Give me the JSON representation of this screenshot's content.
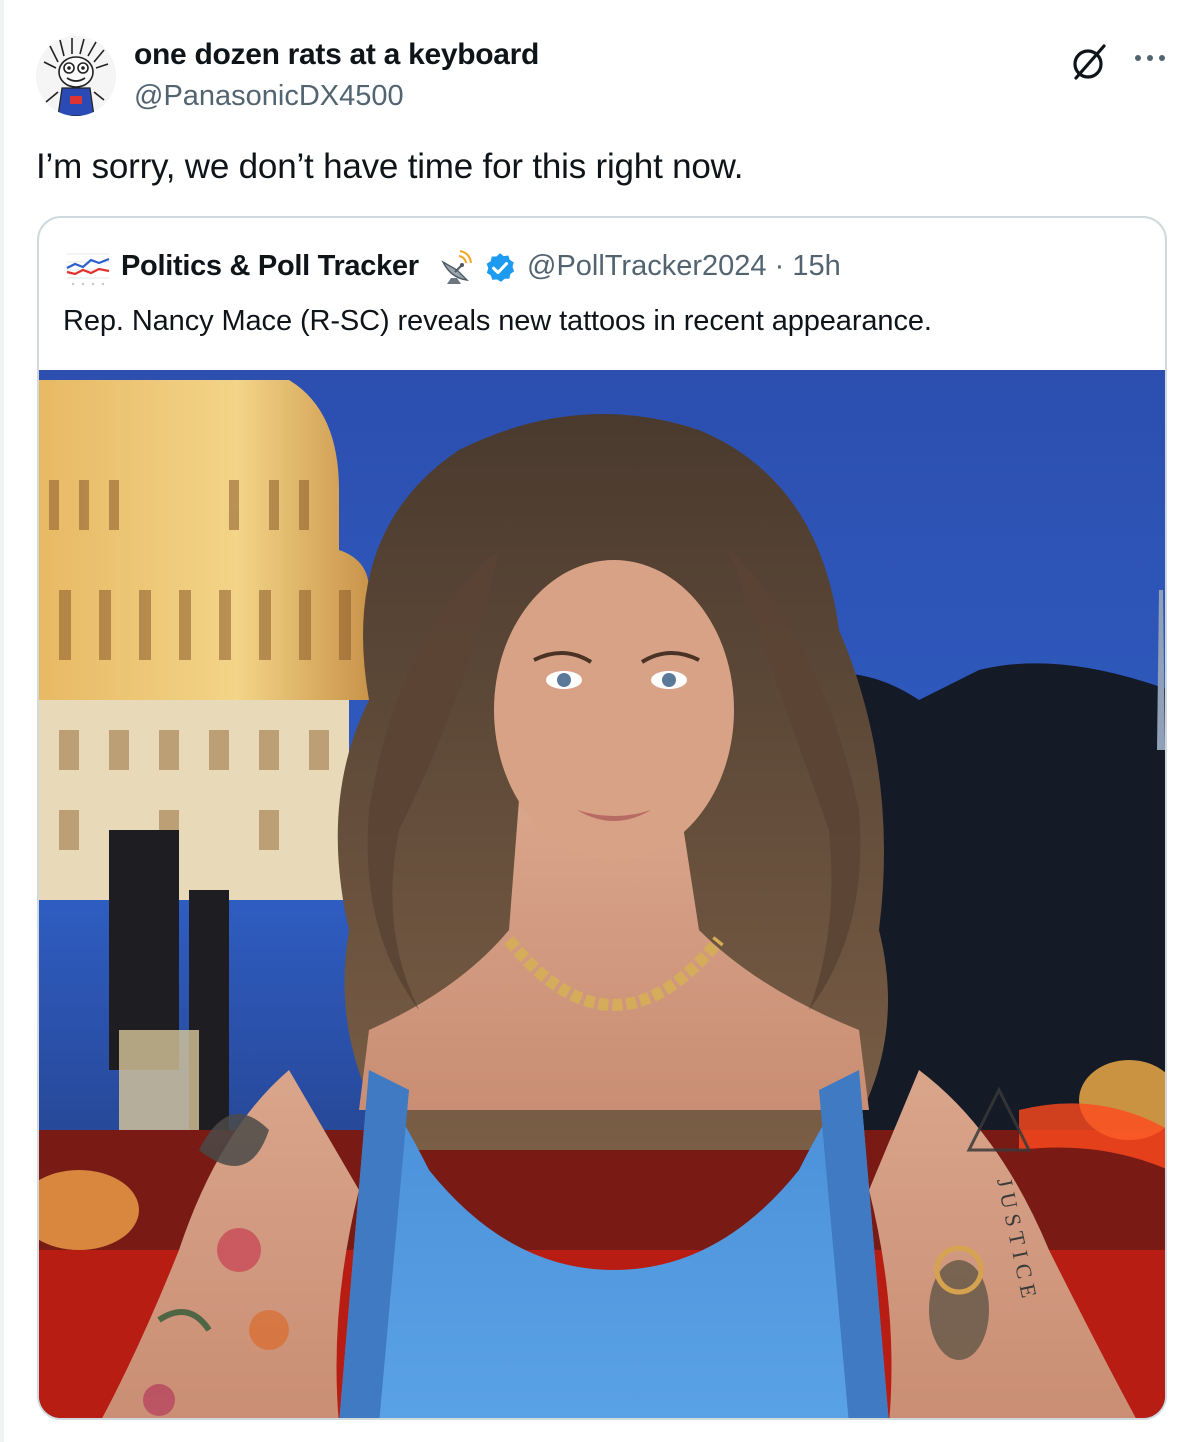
{
  "tweet": {
    "author_name": "one dozen rats at a keyboard",
    "author_handle": "@PanasonicDX4500",
    "text": "I’m sorry, we don’t have time for this right now."
  },
  "actions": {
    "grok_icon": "grok-icon",
    "more_icon": "more-options-icon",
    "more_label": "···"
  },
  "quote": {
    "author_name": "Politics & Poll Tracker",
    "author_handle": "@PollTracker2024",
    "separator": " · ",
    "time": "15h",
    "text": "Rep. Nancy Mace (R-SC) reveals new tattoos in recent appearance.",
    "photo_tattoo_text": "JUSTICE",
    "verified_color": "#1d9bf0"
  },
  "colors": {
    "text_primary": "#0f1419",
    "text_secondary": "#536471",
    "card_border": "#cfd9de",
    "dress_blue": "#4a8fd8",
    "sky_blue": "#1c3a8a"
  }
}
